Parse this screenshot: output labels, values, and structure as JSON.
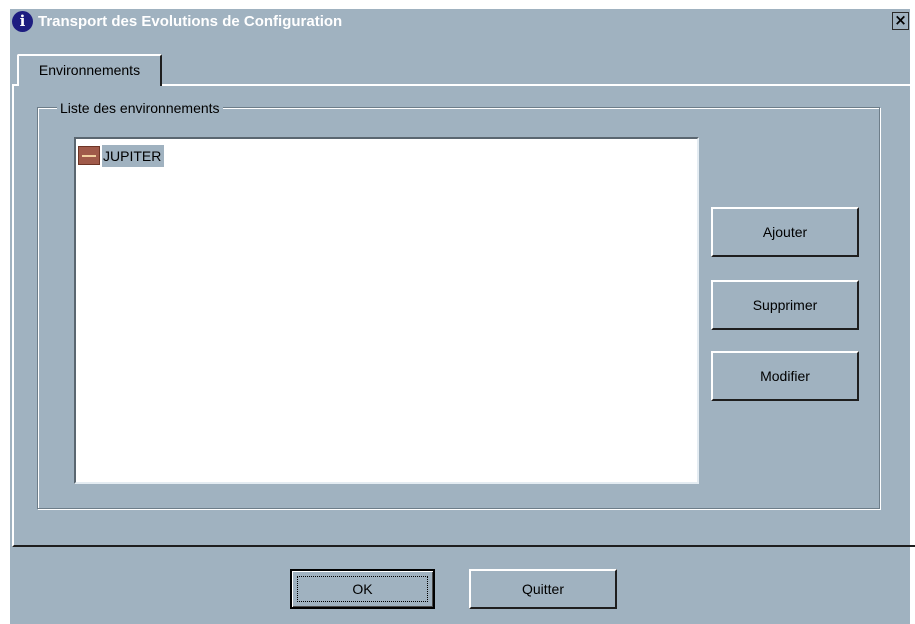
{
  "window": {
    "title": "Transport des Evolutions de Configuration",
    "close_label": "×"
  },
  "tabs": [
    {
      "label": "Environnements",
      "active": true
    }
  ],
  "group": {
    "label": "Liste des environnements"
  },
  "environments": [
    {
      "name": "JUPITER",
      "selected": true,
      "icon": "environment-icon"
    }
  ],
  "side_buttons": {
    "add": "Ajouter",
    "delete": "Supprimer",
    "modify": "Modifier"
  },
  "footer_buttons": {
    "ok": "OK",
    "quit": "Quitter"
  },
  "colors": {
    "face": "#a0b2c0",
    "selection": "#a0b2c0",
    "title_icon": "#1d1d80"
  }
}
